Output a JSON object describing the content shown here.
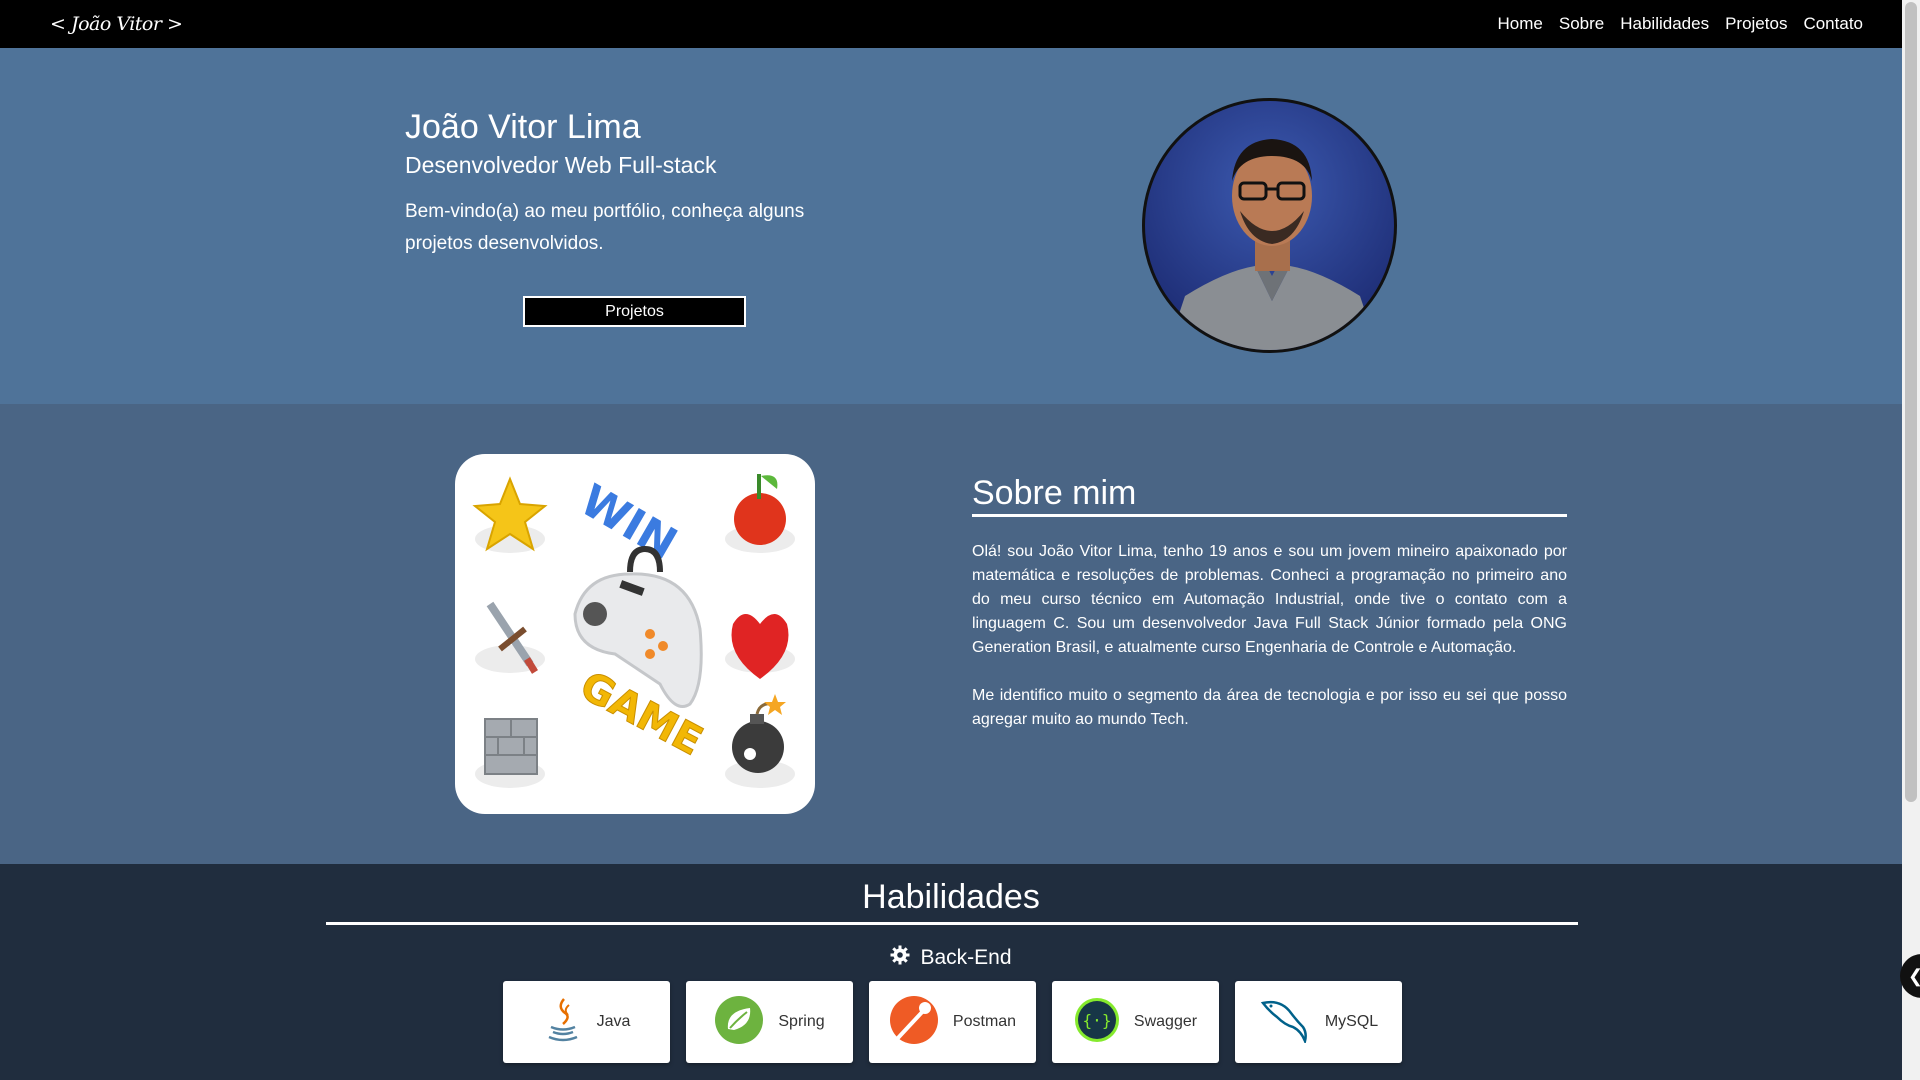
{
  "navbar": {
    "logo": "< João Vitor >",
    "links": [
      "Home",
      "Sobre",
      "Habilidades",
      "Projetos",
      "Contato"
    ]
  },
  "hero": {
    "name": "João Vitor Lima",
    "role": "Desenvolvedor Web Full-stack",
    "intro": "Bem-vindo(a) ao meu portfólio, conheça alguns projetos desenvolvidos.",
    "button": "Projetos"
  },
  "sobre": {
    "title": "Sobre mim",
    "paragraph1": "Olá! sou João Vitor Lima, tenho 19 anos e sou um jovem mineiro apaixonado por matemática e resoluções de problemas. Conheci a programação no primeiro ano do meu curso técnico em Automação Industrial, onde tive o contato com a linguagem C. Sou um desenvolvedor Java Full Stack Júnior formado pela ONG Generation Brasil, e atualmente curso Engenharia de Controle e Automação.",
    "paragraph2": "Me identifico muito o segmento da área de tecnologia e por isso eu sei que posso agregar muito ao mundo Tech."
  },
  "habilidades": {
    "title": "Habilidades",
    "category": "Back-End",
    "skills": [
      {
        "name": "Java",
        "icon": "java-icon"
      },
      {
        "name": "Spring",
        "icon": "spring-icon"
      },
      {
        "name": "Postman",
        "icon": "postman-icon"
      },
      {
        "name": "Swagger",
        "icon": "swagger-icon"
      },
      {
        "name": "MySQL",
        "icon": "mysql-icon"
      }
    ]
  },
  "colors": {
    "navbar": "#000000",
    "hero_bg": "#4f7399",
    "sobre_bg": "#4a6585",
    "habilidades_bg": "#202d3e"
  }
}
